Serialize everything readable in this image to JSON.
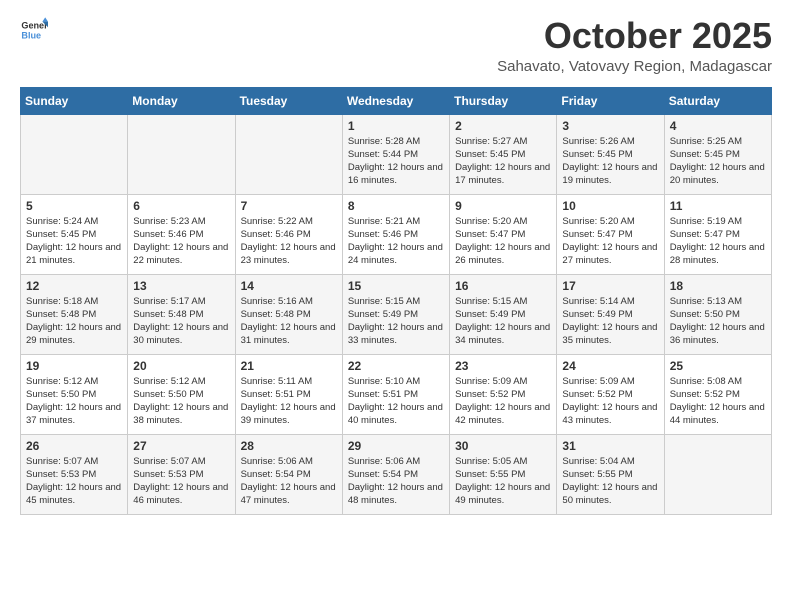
{
  "header": {
    "logo_general": "General",
    "logo_blue": "Blue",
    "month_title": "October 2025",
    "location": "Sahavato, Vatovavy Region, Madagascar"
  },
  "days_of_week": [
    "Sunday",
    "Monday",
    "Tuesday",
    "Wednesday",
    "Thursday",
    "Friday",
    "Saturday"
  ],
  "weeks": [
    [
      {
        "day": "",
        "sunrise": "",
        "sunset": "",
        "daylight": ""
      },
      {
        "day": "",
        "sunrise": "",
        "sunset": "",
        "daylight": ""
      },
      {
        "day": "",
        "sunrise": "",
        "sunset": "",
        "daylight": ""
      },
      {
        "day": "1",
        "sunrise": "Sunrise: 5:28 AM",
        "sunset": "Sunset: 5:44 PM",
        "daylight": "Daylight: 12 hours and 16 minutes."
      },
      {
        "day": "2",
        "sunrise": "Sunrise: 5:27 AM",
        "sunset": "Sunset: 5:45 PM",
        "daylight": "Daylight: 12 hours and 17 minutes."
      },
      {
        "day": "3",
        "sunrise": "Sunrise: 5:26 AM",
        "sunset": "Sunset: 5:45 PM",
        "daylight": "Daylight: 12 hours and 19 minutes."
      },
      {
        "day": "4",
        "sunrise": "Sunrise: 5:25 AM",
        "sunset": "Sunset: 5:45 PM",
        "daylight": "Daylight: 12 hours and 20 minutes."
      }
    ],
    [
      {
        "day": "5",
        "sunrise": "Sunrise: 5:24 AM",
        "sunset": "Sunset: 5:45 PM",
        "daylight": "Daylight: 12 hours and 21 minutes."
      },
      {
        "day": "6",
        "sunrise": "Sunrise: 5:23 AM",
        "sunset": "Sunset: 5:46 PM",
        "daylight": "Daylight: 12 hours and 22 minutes."
      },
      {
        "day": "7",
        "sunrise": "Sunrise: 5:22 AM",
        "sunset": "Sunset: 5:46 PM",
        "daylight": "Daylight: 12 hours and 23 minutes."
      },
      {
        "day": "8",
        "sunrise": "Sunrise: 5:21 AM",
        "sunset": "Sunset: 5:46 PM",
        "daylight": "Daylight: 12 hours and 24 minutes."
      },
      {
        "day": "9",
        "sunrise": "Sunrise: 5:20 AM",
        "sunset": "Sunset: 5:47 PM",
        "daylight": "Daylight: 12 hours and 26 minutes."
      },
      {
        "day": "10",
        "sunrise": "Sunrise: 5:20 AM",
        "sunset": "Sunset: 5:47 PM",
        "daylight": "Daylight: 12 hours and 27 minutes."
      },
      {
        "day": "11",
        "sunrise": "Sunrise: 5:19 AM",
        "sunset": "Sunset: 5:47 PM",
        "daylight": "Daylight: 12 hours and 28 minutes."
      }
    ],
    [
      {
        "day": "12",
        "sunrise": "Sunrise: 5:18 AM",
        "sunset": "Sunset: 5:48 PM",
        "daylight": "Daylight: 12 hours and 29 minutes."
      },
      {
        "day": "13",
        "sunrise": "Sunrise: 5:17 AM",
        "sunset": "Sunset: 5:48 PM",
        "daylight": "Daylight: 12 hours and 30 minutes."
      },
      {
        "day": "14",
        "sunrise": "Sunrise: 5:16 AM",
        "sunset": "Sunset: 5:48 PM",
        "daylight": "Daylight: 12 hours and 31 minutes."
      },
      {
        "day": "15",
        "sunrise": "Sunrise: 5:15 AM",
        "sunset": "Sunset: 5:49 PM",
        "daylight": "Daylight: 12 hours and 33 minutes."
      },
      {
        "day": "16",
        "sunrise": "Sunrise: 5:15 AM",
        "sunset": "Sunset: 5:49 PM",
        "daylight": "Daylight: 12 hours and 34 minutes."
      },
      {
        "day": "17",
        "sunrise": "Sunrise: 5:14 AM",
        "sunset": "Sunset: 5:49 PM",
        "daylight": "Daylight: 12 hours and 35 minutes."
      },
      {
        "day": "18",
        "sunrise": "Sunrise: 5:13 AM",
        "sunset": "Sunset: 5:50 PM",
        "daylight": "Daylight: 12 hours and 36 minutes."
      }
    ],
    [
      {
        "day": "19",
        "sunrise": "Sunrise: 5:12 AM",
        "sunset": "Sunset: 5:50 PM",
        "daylight": "Daylight: 12 hours and 37 minutes."
      },
      {
        "day": "20",
        "sunrise": "Sunrise: 5:12 AM",
        "sunset": "Sunset: 5:50 PM",
        "daylight": "Daylight: 12 hours and 38 minutes."
      },
      {
        "day": "21",
        "sunrise": "Sunrise: 5:11 AM",
        "sunset": "Sunset: 5:51 PM",
        "daylight": "Daylight: 12 hours and 39 minutes."
      },
      {
        "day": "22",
        "sunrise": "Sunrise: 5:10 AM",
        "sunset": "Sunset: 5:51 PM",
        "daylight": "Daylight: 12 hours and 40 minutes."
      },
      {
        "day": "23",
        "sunrise": "Sunrise: 5:09 AM",
        "sunset": "Sunset: 5:52 PM",
        "daylight": "Daylight: 12 hours and 42 minutes."
      },
      {
        "day": "24",
        "sunrise": "Sunrise: 5:09 AM",
        "sunset": "Sunset: 5:52 PM",
        "daylight": "Daylight: 12 hours and 43 minutes."
      },
      {
        "day": "25",
        "sunrise": "Sunrise: 5:08 AM",
        "sunset": "Sunset: 5:52 PM",
        "daylight": "Daylight: 12 hours and 44 minutes."
      }
    ],
    [
      {
        "day": "26",
        "sunrise": "Sunrise: 5:07 AM",
        "sunset": "Sunset: 5:53 PM",
        "daylight": "Daylight: 12 hours and 45 minutes."
      },
      {
        "day": "27",
        "sunrise": "Sunrise: 5:07 AM",
        "sunset": "Sunset: 5:53 PM",
        "daylight": "Daylight: 12 hours and 46 minutes."
      },
      {
        "day": "28",
        "sunrise": "Sunrise: 5:06 AM",
        "sunset": "Sunset: 5:54 PM",
        "daylight": "Daylight: 12 hours and 47 minutes."
      },
      {
        "day": "29",
        "sunrise": "Sunrise: 5:06 AM",
        "sunset": "Sunset: 5:54 PM",
        "daylight": "Daylight: 12 hours and 48 minutes."
      },
      {
        "day": "30",
        "sunrise": "Sunrise: 5:05 AM",
        "sunset": "Sunset: 5:55 PM",
        "daylight": "Daylight: 12 hours and 49 minutes."
      },
      {
        "day": "31",
        "sunrise": "Sunrise: 5:04 AM",
        "sunset": "Sunset: 5:55 PM",
        "daylight": "Daylight: 12 hours and 50 minutes."
      },
      {
        "day": "",
        "sunrise": "",
        "sunset": "",
        "daylight": ""
      }
    ]
  ]
}
